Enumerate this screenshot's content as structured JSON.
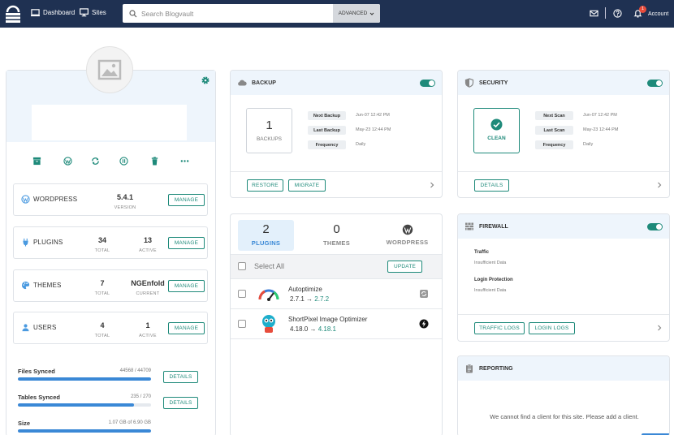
{
  "topbar": {
    "nav": [
      {
        "label": "Dashboard",
        "icon": "dashboard-icon"
      },
      {
        "label": "Sites",
        "icon": "monitor-icon"
      }
    ],
    "search_placeholder": "Search Blogvault",
    "advanced_label": "ADVANCED",
    "notification_count": "1",
    "account_label": "Account"
  },
  "site": {
    "stats": [
      {
        "label": "WORDPRESS",
        "value": "5.4.1",
        "value_sub": "VERSION",
        "button": "MANAGE"
      },
      {
        "label": "PLUGINS",
        "total": "34",
        "total_sub": "TOTAL",
        "active": "13",
        "active_sub": "ACTIVE",
        "button": "MANAGE"
      },
      {
        "label": "THEMES",
        "total": "7",
        "total_sub": "TOTAL",
        "active": "NGEnfold",
        "active_sub": "CURRENT",
        "button": "MANAGE"
      },
      {
        "label": "USERS",
        "total": "4",
        "total_sub": "TOTAL",
        "active": "1",
        "active_sub": "ACTIVE",
        "button": "MANAGE"
      }
    ],
    "sync": [
      {
        "label": "Files Synced",
        "value": "44568 / 44709",
        "progress": 0.997,
        "button": "DETAILS"
      },
      {
        "label": "Tables Synced",
        "value": "235 / 270",
        "progress": 0.87,
        "button": "DETAILS"
      },
      {
        "label": "Size",
        "value": "1.07 GB of 6.90 GB",
        "progress": 1.0
      }
    ]
  },
  "backup": {
    "title": "BACKUP",
    "count": "1",
    "count_label": "BACKUPS",
    "rows": [
      {
        "key": "Next Backup",
        "value": "Jun-07 12:42 PM"
      },
      {
        "key": "Last Backup",
        "value": "May-23 12:44 PM"
      },
      {
        "key": "Frequency",
        "value": "Daily"
      }
    ],
    "restore_label": "RESTORE",
    "migrate_label": "MIGRATE"
  },
  "security": {
    "title": "SECURITY",
    "status": "CLEAN",
    "rows": [
      {
        "key": "Next Scan",
        "value": "Jun-07 12:42 PM"
      },
      {
        "key": "Last Scan",
        "value": "May-23 12:44 PM"
      },
      {
        "key": "Frequency",
        "value": "Daily"
      }
    ],
    "details_label": "DETAILS"
  },
  "updates": {
    "tabs": [
      {
        "count": "2",
        "label": "PLUGINS"
      },
      {
        "count": "0",
        "label": "THEMES"
      },
      {
        "label": "WORDPRESS"
      }
    ],
    "select_all": "Select All",
    "update_label": "UPDATE",
    "plugins": [
      {
        "name": "Autoptimize",
        "from": "2.7.1",
        "to": "2.7.2"
      },
      {
        "name": "ShortPixel Image Optimizer",
        "from": "4.18.0",
        "to": "4.18.1"
      }
    ],
    "arrow": "→"
  },
  "firewall": {
    "title": "FIREWALL",
    "items": [
      {
        "label": "Traffic",
        "value": "Insufficient Data"
      },
      {
        "label": "Login Protection",
        "value": "Insufficient Data"
      }
    ],
    "traffic_logs": "TRAFFIC LOGS",
    "login_logs": "LOGIN LOGS"
  },
  "reporting": {
    "title": "REPORTING",
    "message": "We cannot find a client for this site. Please add a client."
  },
  "colors": {
    "nav_bg": "#1f3152",
    "accent": "#1e8a7a",
    "blue": "#3a88d6"
  }
}
